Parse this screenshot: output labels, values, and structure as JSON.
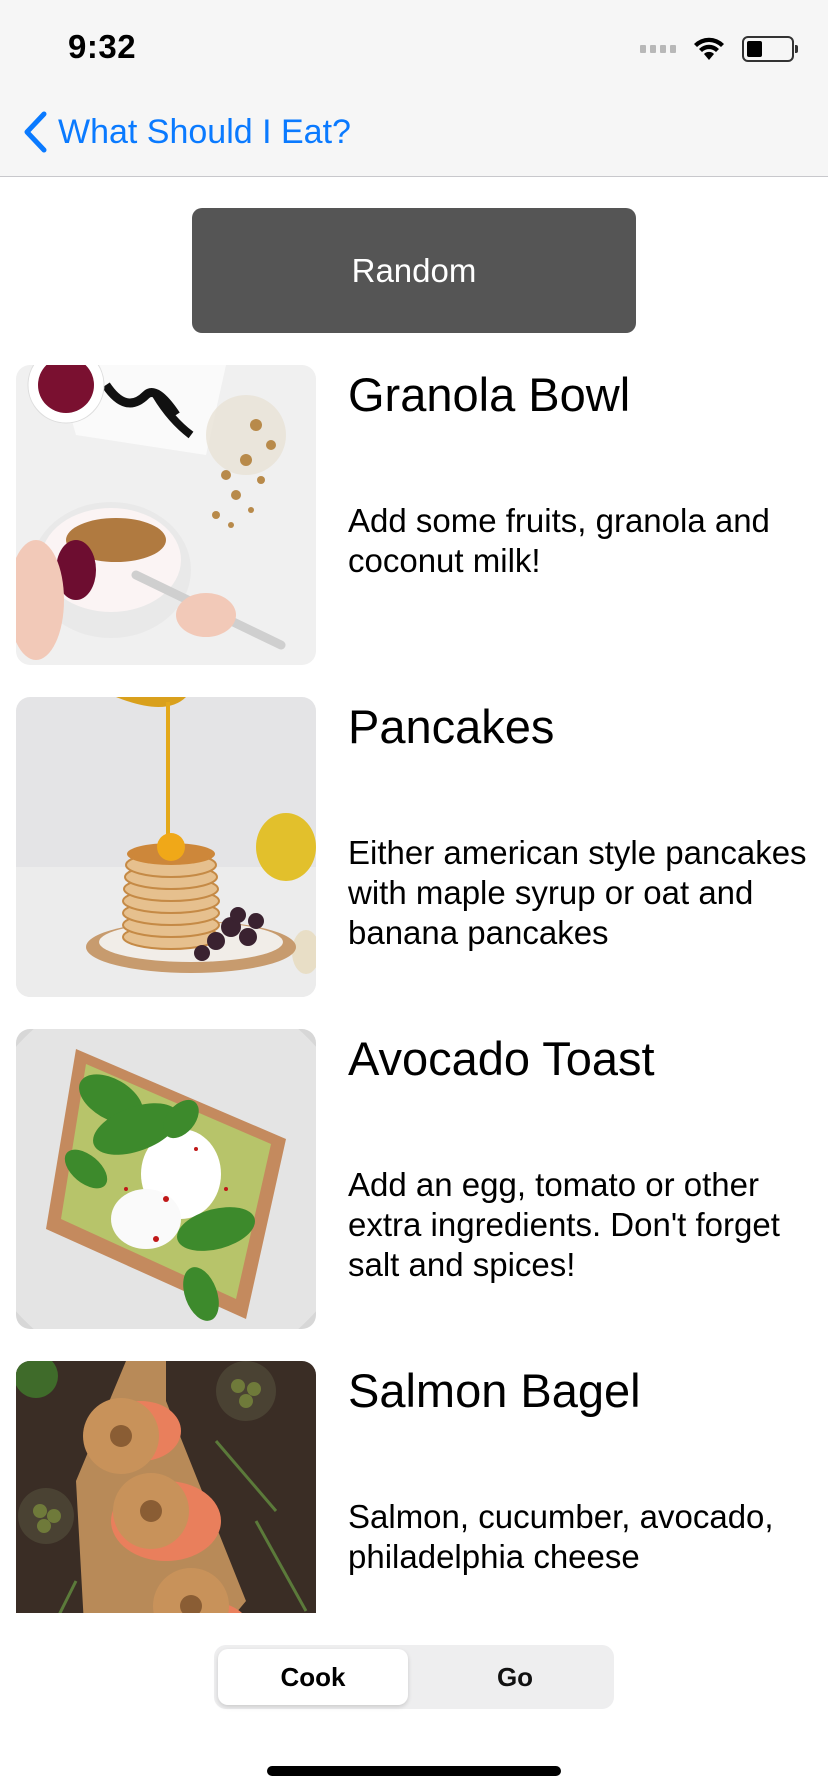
{
  "status_bar": {
    "time": "9:32",
    "icons": [
      "signal-icon",
      "wifi-icon",
      "battery-icon"
    ]
  },
  "nav": {
    "back_icon": "chevron-left-icon",
    "back_label": "What Should I Eat?"
  },
  "random_button": {
    "label": "Random"
  },
  "recipes": [
    {
      "title": "Granola Bowl",
      "description": "Add some fruits, granola and coconut milk!",
      "image": "granola-bowl-photo"
    },
    {
      "title": "Pancakes",
      "description": "Either american style pancakes with maple syrup or oat and banana pancakes",
      "image": "pancakes-photo"
    },
    {
      "title": "Avocado Toast",
      "description": "Add an egg, tomato or other extra ingredients. Don't forget salt and spices!",
      "image": "avocado-toast-photo"
    },
    {
      "title": "Salmon Bagel",
      "description": "Salmon, cucumber, avocado, philadelphia cheese",
      "image": "salmon-bagel-photo"
    }
  ],
  "segmented_control": {
    "options": [
      "Cook",
      "Go"
    ],
    "selected": "Cook"
  },
  "colors": {
    "accent": "#0a7aff",
    "button_bg": "#555555",
    "bar_bg": "#f6f6f6"
  }
}
